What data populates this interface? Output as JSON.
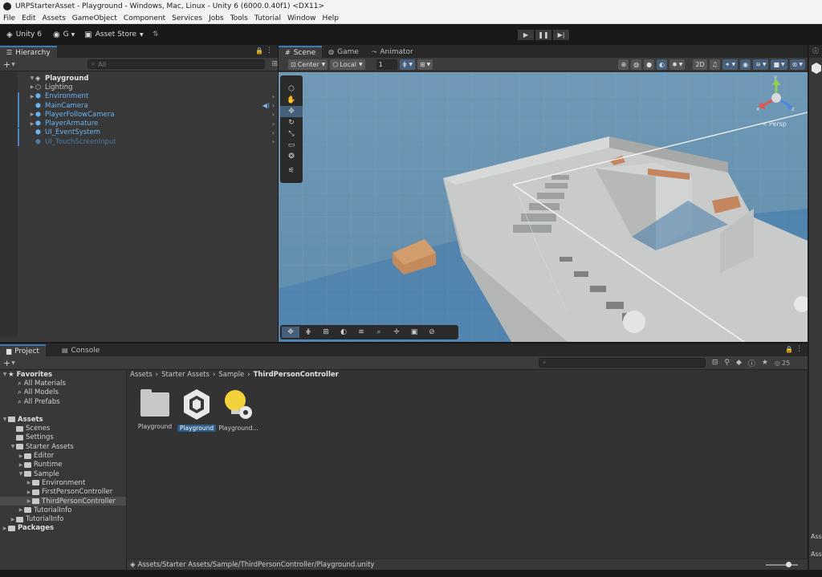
{
  "window": {
    "title": "URPStarterAsset - Playground - Windows, Mac, Linux - Unity 6 (6000.0.40f1) <DX11>"
  },
  "menu": [
    "File",
    "Edit",
    "Assets",
    "GameObject",
    "Component",
    "Services",
    "Jobs",
    "Tools",
    "Tutorial",
    "Window",
    "Help"
  ],
  "toolbar": {
    "unity_label": "Unity 6",
    "account_label": "G",
    "asset_store_label": "Asset Store"
  },
  "hierarchy": {
    "tab_label": "Hierarchy",
    "search_placeholder": "All",
    "root": "Playground",
    "items": [
      {
        "label": "Lighting",
        "color": "#c8c8c8",
        "expandable": true
      },
      {
        "label": "Environment",
        "color": "#6ab4f5",
        "expandable": true
      },
      {
        "label": "MainCamera",
        "color": "#6ab4f5",
        "expandable": false
      },
      {
        "label": "PlayerFollowCamera",
        "color": "#6ab4f5",
        "expandable": true
      },
      {
        "label": "PlayerArmature",
        "color": "#6ab4f5",
        "expandable": true
      },
      {
        "label": "UI_EventSystem",
        "color": "#6ab4f5",
        "expandable": false
      },
      {
        "label": "UI_TouchScreenInput",
        "color": "#4e7aa3",
        "expandable": false
      }
    ]
  },
  "scene": {
    "tabs": [
      "Scene",
      "Game",
      "Animator"
    ],
    "pivot_label": "Center",
    "space_label": "Local",
    "snap_value": "1",
    "persp_label": "Persp",
    "gizmo_axes": {
      "y": "y",
      "x": "x",
      "z": "z"
    }
  },
  "project": {
    "tabs": [
      "Project",
      "Console"
    ],
    "hidden_count": "25",
    "favorites_label": "Favorites",
    "favorites": [
      "All Materials",
      "All Models",
      "All Prefabs"
    ],
    "assets_label": "Assets",
    "tree": [
      {
        "label": "Scenes",
        "level": 1,
        "tri": false
      },
      {
        "label": "Settings",
        "level": 1,
        "tri": false
      },
      {
        "label": "Starter Assets",
        "level": 1,
        "tri": true,
        "open": true
      },
      {
        "label": "Editor",
        "level": 2,
        "tri": true
      },
      {
        "label": "Runtime",
        "level": 2,
        "tri": true
      },
      {
        "label": "Sample",
        "level": 2,
        "tri": true,
        "open": true
      },
      {
        "label": "Environment",
        "level": 3,
        "tri": true
      },
      {
        "label": "FirstPersonController",
        "level": 3,
        "tri": true
      },
      {
        "label": "ThirdPersonController",
        "level": 3,
        "tri": true,
        "selected": true
      },
      {
        "label": "TutorialInfo",
        "level": 2,
        "tri": true
      },
      {
        "label": "TutorialInfo",
        "level": 1,
        "tri": true
      }
    ],
    "packages_label": "Packages",
    "breadcrumb": [
      "Assets",
      "Starter Assets",
      "Sample",
      "ThirdPersonController"
    ],
    "files": [
      {
        "label": "Playground",
        "kind": "folder"
      },
      {
        "label": "Playground",
        "kind": "scene",
        "selected": true
      },
      {
        "label": "Playground...",
        "kind": "lighting"
      }
    ],
    "footer_path": "Assets/Starter Assets/Sample/ThirdPersonController/Playground.unity"
  },
  "inspector": {
    "partial_label": "Ass"
  },
  "colors": {
    "accent": "#3a79bb",
    "selection": "#2c5d87"
  }
}
